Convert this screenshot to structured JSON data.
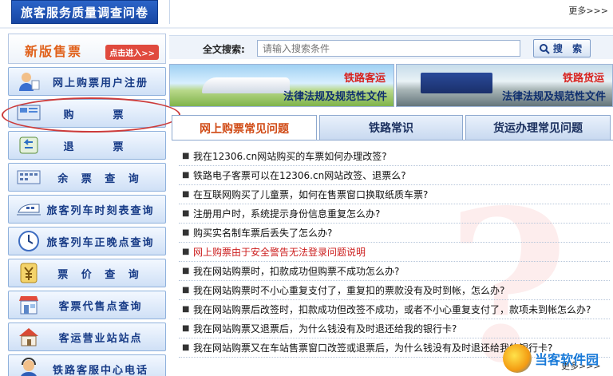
{
  "top": {
    "survey_banner": "旅客服务质量调查问卷",
    "more": "更多>>>"
  },
  "sidebar": {
    "new_ticket_title": "新版售票",
    "new_ticket_link": "点击进入>>",
    "items": [
      {
        "label": "网上购票用户注册",
        "icon": "user-register-icon"
      },
      {
        "label": "购　票",
        "icon": "ticket-screen-icon"
      },
      {
        "label": "退　票",
        "icon": "refund-arrow-icon"
      },
      {
        "label": "余 票 查 询",
        "icon": "seat-query-icon"
      },
      {
        "label": "旅客列车时刻表查询",
        "icon": "train-icon"
      },
      {
        "label": "旅客列车正晚点查询",
        "icon": "clock-icon"
      },
      {
        "label": "票 价 查 询",
        "icon": "yuan-icon"
      },
      {
        "label": "客票代售点查询",
        "icon": "agency-store-icon"
      },
      {
        "label": "客运营业站站点",
        "icon": "station-house-icon"
      },
      {
        "label": "铁路客服中心电话",
        "icon": "service-agent-icon"
      }
    ]
  },
  "search": {
    "label": "全文搜索:",
    "placeholder": "请输入搜索条件",
    "button": "搜 索"
  },
  "laws": {
    "passenger": {
      "tag": "铁路客运",
      "caption": "法律法规及规范性文件"
    },
    "freight": {
      "tag": "铁路货运",
      "caption": "法律法规及规范性文件"
    }
  },
  "tabs": [
    {
      "label": "网上购票常见问题",
      "active": true
    },
    {
      "label": "铁路常识",
      "active": false
    },
    {
      "label": "货运办理常见问题",
      "active": false
    }
  ],
  "faq": [
    "我在12306.cn网站购买的车票如何办理改签?",
    "铁路电子客票可以在12306.cn网站改签、退票么?",
    "在互联网购买了儿童票，如何在售票窗口换取纸质车票?",
    "注册用户时，系统提示身份信息重复怎么办?",
    "购买实名制车票后丢失了怎么办?",
    "网上购票由于安全警告无法登录问题说明",
    "我在网站购票时，扣款成功但购票不成功怎么办?",
    "我在网站购票时不小心重复支付了，重复扣的票款没有及时到帐，怎么办?",
    "我在网站购票后改签时，扣款成功但改签不成功，或者不小心重复支付了，款项未到帐怎么办?",
    "我在网站购票又退票后，为什么钱没有及时退还给我的银行卡?",
    "我在网站购票又在车站售票窗口改签或退票后，为什么钱没有及时退还给我的银行卡?"
  ],
  "faq_more": "更多>>>",
  "watermark": {
    "text": "当客软件园"
  },
  "colors": {
    "accent": "#d04a15",
    "nav": "#163a86",
    "warn": "#cc1f1f"
  }
}
